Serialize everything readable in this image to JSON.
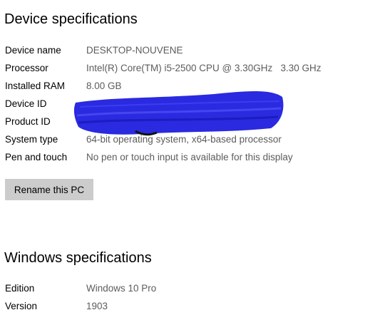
{
  "device_specs": {
    "title": "Device specifications",
    "rows": [
      {
        "label": "Device name",
        "value": "DESKTOP-NOUVENE"
      },
      {
        "label": "Processor",
        "value": "Intel(R) Core(TM) i5-2500 CPU @ 3.30GHz   3.30 GHz"
      },
      {
        "label": "Installed RAM",
        "value": "8.00 GB"
      },
      {
        "label": "Device ID",
        "value": ""
      },
      {
        "label": "Product ID",
        "value": ""
      },
      {
        "label": "System type",
        "value": "64-bit operating system, x64-based processor"
      },
      {
        "label": "Pen and touch",
        "value": "No pen or touch input is available for this display"
      }
    ],
    "rename_button": "Rename this PC"
  },
  "windows_specs": {
    "title": "Windows specifications",
    "rows": [
      {
        "label": "Edition",
        "value": "Windows 10 Pro"
      },
      {
        "label": "Version",
        "value": "1903"
      }
    ]
  },
  "colors": {
    "redaction": "#2a2ae0",
    "button_bg": "#cccccc",
    "value_text": "#5c5c5c"
  }
}
